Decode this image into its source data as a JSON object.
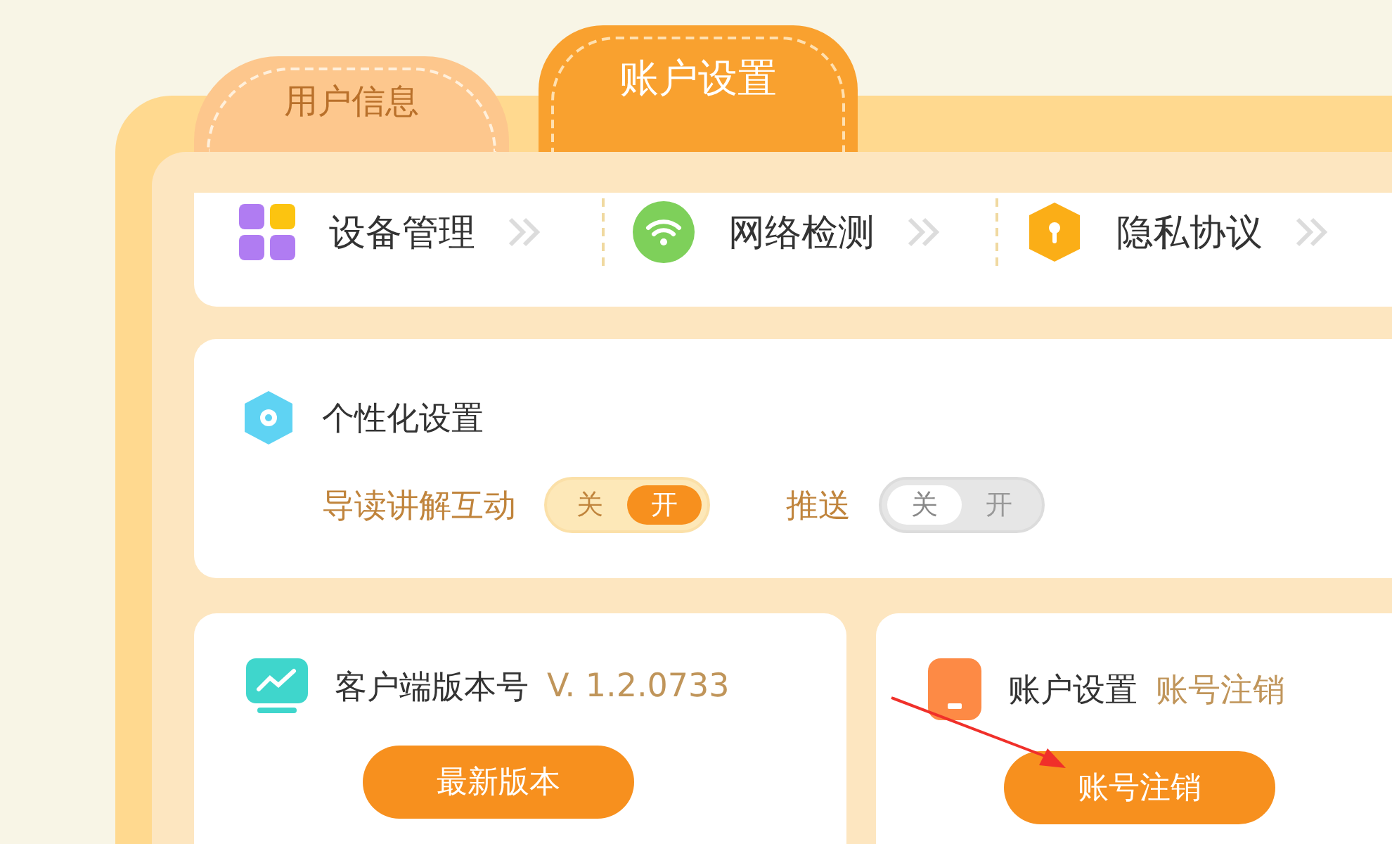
{
  "tabs": [
    {
      "label": "用户信息",
      "selected": false
    },
    {
      "label": "账户设置",
      "selected": true
    }
  ],
  "menu": [
    {
      "label": "设备管理"
    },
    {
      "label": "网络检测"
    },
    {
      "label": "隐私协议"
    }
  ],
  "personalization": {
    "title": "个性化设置",
    "toggles": [
      {
        "label": "导读讲解互动",
        "on": true,
        "options": [
          {
            "label": "关",
            "selected": false
          },
          {
            "label": "开",
            "selected": true
          }
        ]
      },
      {
        "label": "推送",
        "on": false,
        "options": [
          {
            "label": "关",
            "selected": true
          },
          {
            "label": "开",
            "selected": false
          }
        ]
      }
    ]
  },
  "cards": [
    {
      "kind": "version",
      "title": "客户端版本号",
      "detail": "V. 1.2.0733",
      "button": "最新版本"
    },
    {
      "kind": "account",
      "title": "账户设置",
      "detail": "账号注销",
      "button": "账号注销"
    }
  ]
}
